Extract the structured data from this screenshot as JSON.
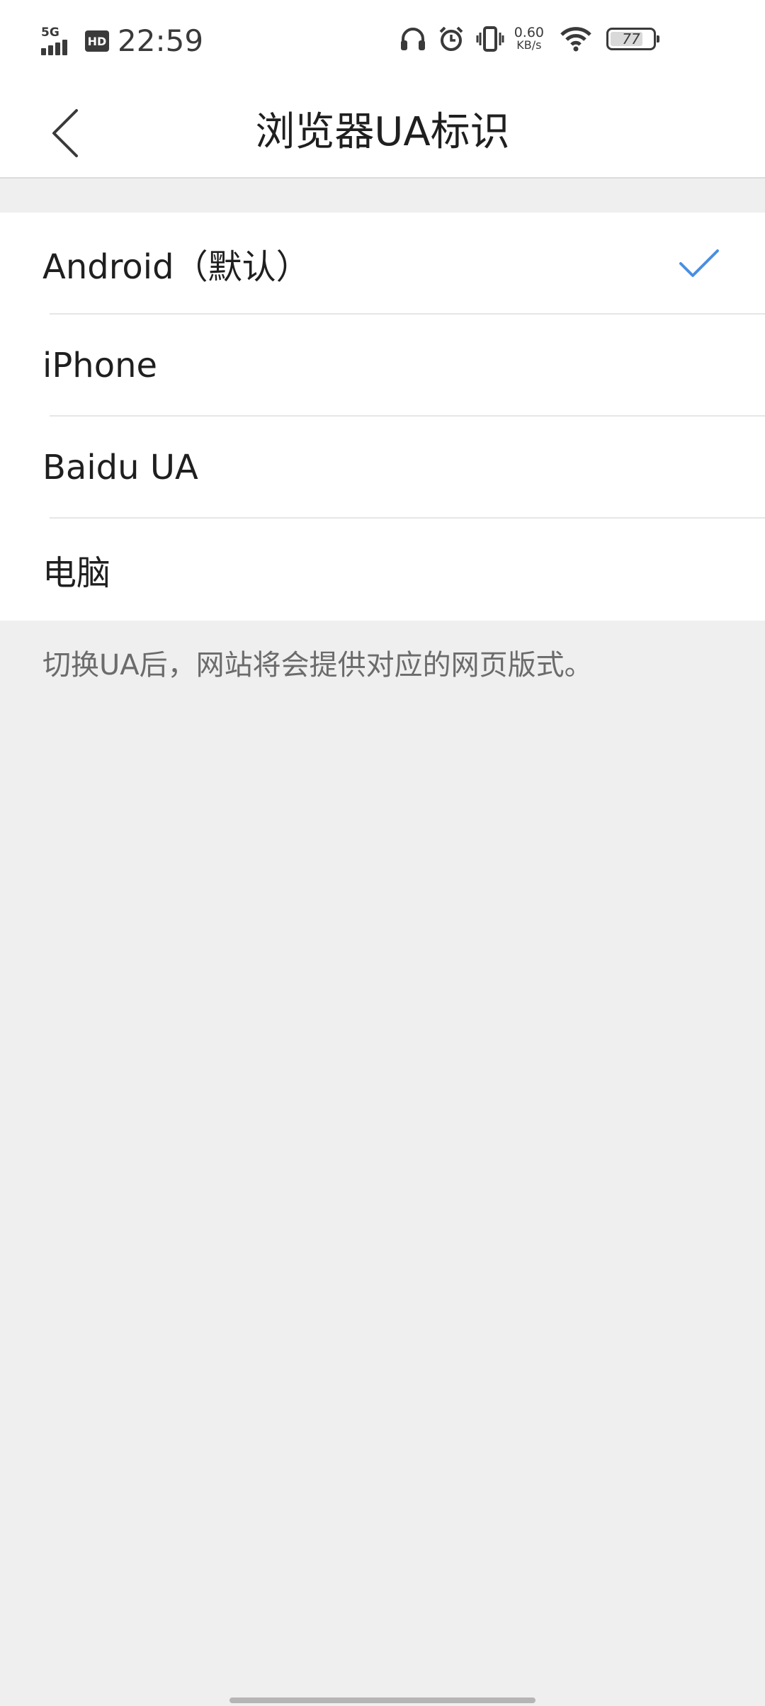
{
  "status_bar": {
    "network": "5G",
    "hd": "HD",
    "time": "22:59",
    "speed_value": "0.60",
    "speed_unit": "KB/s",
    "battery_level": "77",
    "battery_fraction": 0.77
  },
  "header": {
    "title": "浏览器UA标识",
    "back_icon": "chevron-left-icon"
  },
  "options": [
    {
      "label": "Android（默认）",
      "selected": true
    },
    {
      "label": "iPhone",
      "selected": false
    },
    {
      "label": "Baidu UA",
      "selected": false
    },
    {
      "label": "电脑",
      "selected": false
    }
  ],
  "hint": "切换UA后，网站将会提供对应的网页版式。",
  "colors": {
    "accent": "#4a8fe0",
    "background": "#efefef",
    "surface": "#ffffff"
  }
}
